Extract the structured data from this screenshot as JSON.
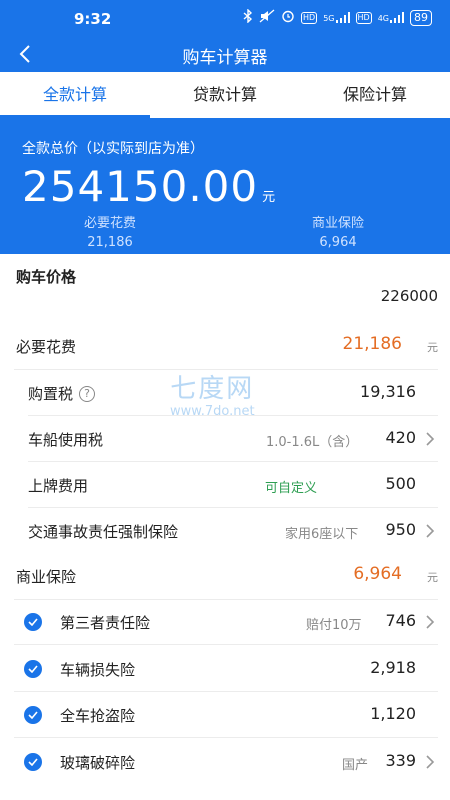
{
  "status": {
    "time": "9:32",
    "net1": "5G",
    "net2": "4G",
    "hd1": "HD",
    "hd2": "HD",
    "battery": "89"
  },
  "nav": {
    "title": "购车计算器"
  },
  "tabs": [
    {
      "label": "全款计算",
      "active": true
    },
    {
      "label": "贷款计算",
      "active": false
    },
    {
      "label": "保险计算",
      "active": false
    }
  ],
  "summary": {
    "label": "全款总价（以实际到店为准）",
    "total": "254150.00",
    "unit": "元",
    "left_label": "必要花费",
    "left_value": "21,186",
    "right_label": "商业保险",
    "right_value": "6,964"
  },
  "car_price": {
    "title": "购车价格",
    "value": "226000"
  },
  "required": {
    "title": "必要花费",
    "value": "21,186",
    "unit": "元",
    "items": [
      {
        "label": "购置税",
        "note": "",
        "value": "19,316"
      },
      {
        "label": "车船使用税",
        "note": "1.0-1.6L（含）",
        "value": "420"
      },
      {
        "label": "上牌费用",
        "note": "可自定义",
        "value": "500"
      },
      {
        "label": "交通事故责任强制保险",
        "note": "家用6座以下",
        "value": "950"
      }
    ]
  },
  "insurance": {
    "title": "商业保险",
    "value": "6,964",
    "unit": "元",
    "items": [
      {
        "label": "第三者责任险",
        "note": "赔付10万",
        "value": "746"
      },
      {
        "label": "车辆损失险",
        "note": "",
        "value": "2,918"
      },
      {
        "label": "全车抢盗险",
        "note": "",
        "value": "1,120"
      },
      {
        "label": "玻璃破碎险",
        "note": "国产",
        "value": "339"
      }
    ]
  },
  "watermark": {
    "big": "七度网",
    "small": "www.7do.net"
  },
  "colors": {
    "primary": "#1a74e8",
    "accent": "#e46d24",
    "green": "#2e9e52"
  }
}
